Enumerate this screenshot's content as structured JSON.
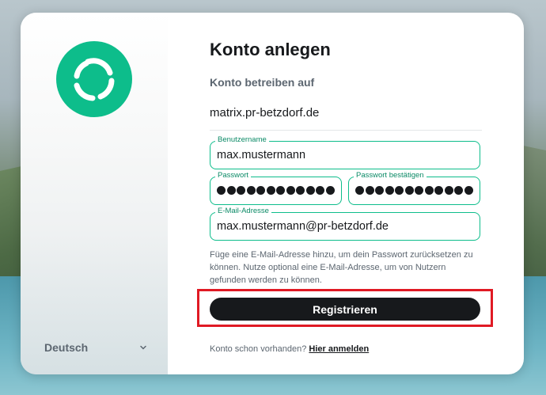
{
  "sidebar": {
    "logo_icon": "element-logo-icon",
    "brand_color": "#0dbd8b",
    "language": "Deutsch",
    "language_icon": "chevron-down-icon"
  },
  "form": {
    "title": "Konto anlegen",
    "server_label": "Konto betreiben auf",
    "server_value": "matrix.pr-betzdorf.de",
    "username": {
      "label": "Benutzername",
      "value": "max.mustermann"
    },
    "password": {
      "label": "Passwort",
      "masked_length": 12
    },
    "password_confirm": {
      "label": "Passwort bestätigen",
      "masked_length": 12
    },
    "email": {
      "label": "E-Mail-Adresse",
      "value": "max.mustermann@pr-betzdorf.de"
    },
    "hint": "Füge eine E-Mail-Adresse hinzu, um dein Passwort zurücksetzen zu können. Nutze optional eine E-Mail-Adresse, um von Nutzern gefunden werden zu können.",
    "submit_label": "Registrieren",
    "footer_text": "Konto schon vorhanden?",
    "footer_link": "Hier anmelden",
    "highlight_color": "#e01a24"
  }
}
